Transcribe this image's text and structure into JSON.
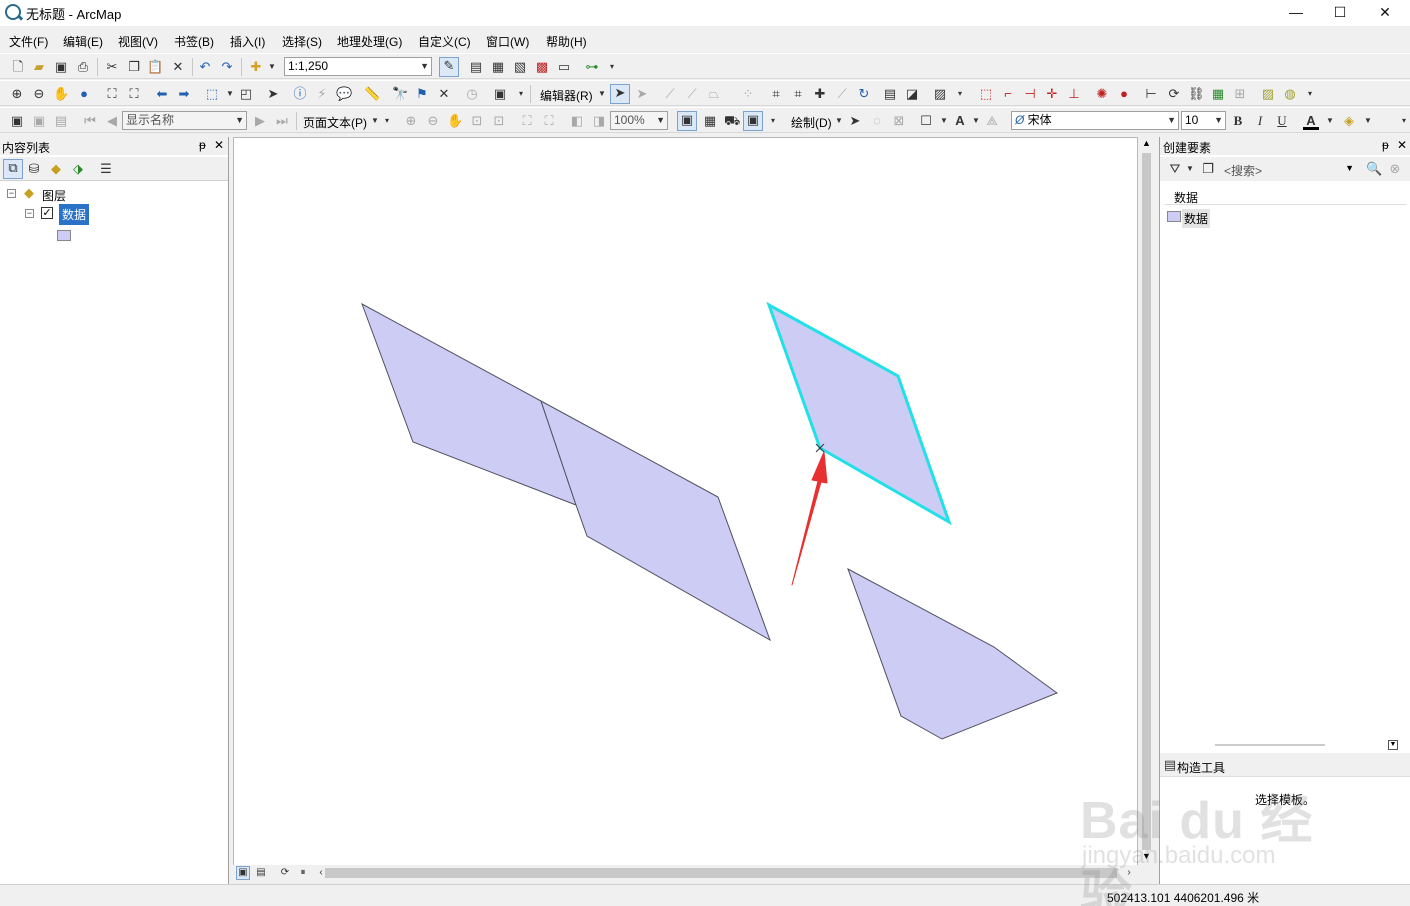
{
  "window": {
    "title": "无标题 - ArcMap",
    "minimize": "—",
    "maximize": "☐",
    "close": "✕"
  },
  "menu": [
    "文件(F)",
    "编辑(E)",
    "视图(V)",
    "书签(B)",
    "插入(I)",
    "选择(S)",
    "地理处理(G)",
    "自定义(C)",
    "窗口(W)",
    "帮助(H)"
  ],
  "toolbar1": {
    "scale": "1:1,250"
  },
  "toolbar2": {
    "editor_label": "编辑器(R)"
  },
  "toolbar3": {
    "display_name": "显示名称",
    "page_text": "页面文本(P)",
    "zoom_percent": "100%",
    "draw_label": "绘制(D)",
    "font_name": "宋体",
    "font_size": "10",
    "bold": "B",
    "italic": "I",
    "underline": "U",
    "font_color_glyph": "A"
  },
  "toc": {
    "title": "内容列表",
    "pin": "ᵽ",
    "close": "✕",
    "root_label": "图层",
    "layer_label": "数据",
    "layer_checked": true
  },
  "create_features": {
    "title": "创建要素",
    "pin": "ᵽ",
    "close": "✕",
    "search_placeholder": "<搜索>",
    "group_label": "数据",
    "template_label": "数据"
  },
  "construction_tools": {
    "title": "构造工具",
    "hint": "选择模板。"
  },
  "status": {
    "coordinates": "502413.101  4406201.496 米"
  },
  "watermark": {
    "logo": "Bai du 经验",
    "url": "jingyan.baidu.com"
  },
  "colors": {
    "polygon_fill": "#ccccf5",
    "polygon_stroke": "#505060",
    "selection": "#22e0e8",
    "arrow": "#e83030"
  },
  "icons": {
    "new": "new-document-icon",
    "open": "open-folder-icon",
    "save": "save-icon",
    "print": "print-icon",
    "cut": "cut-icon",
    "copy": "copy-icon",
    "paste": "paste-icon",
    "delete": "delete-icon",
    "undo": "undo-icon",
    "redo": "redo-icon",
    "add_data": "add-data-icon"
  }
}
